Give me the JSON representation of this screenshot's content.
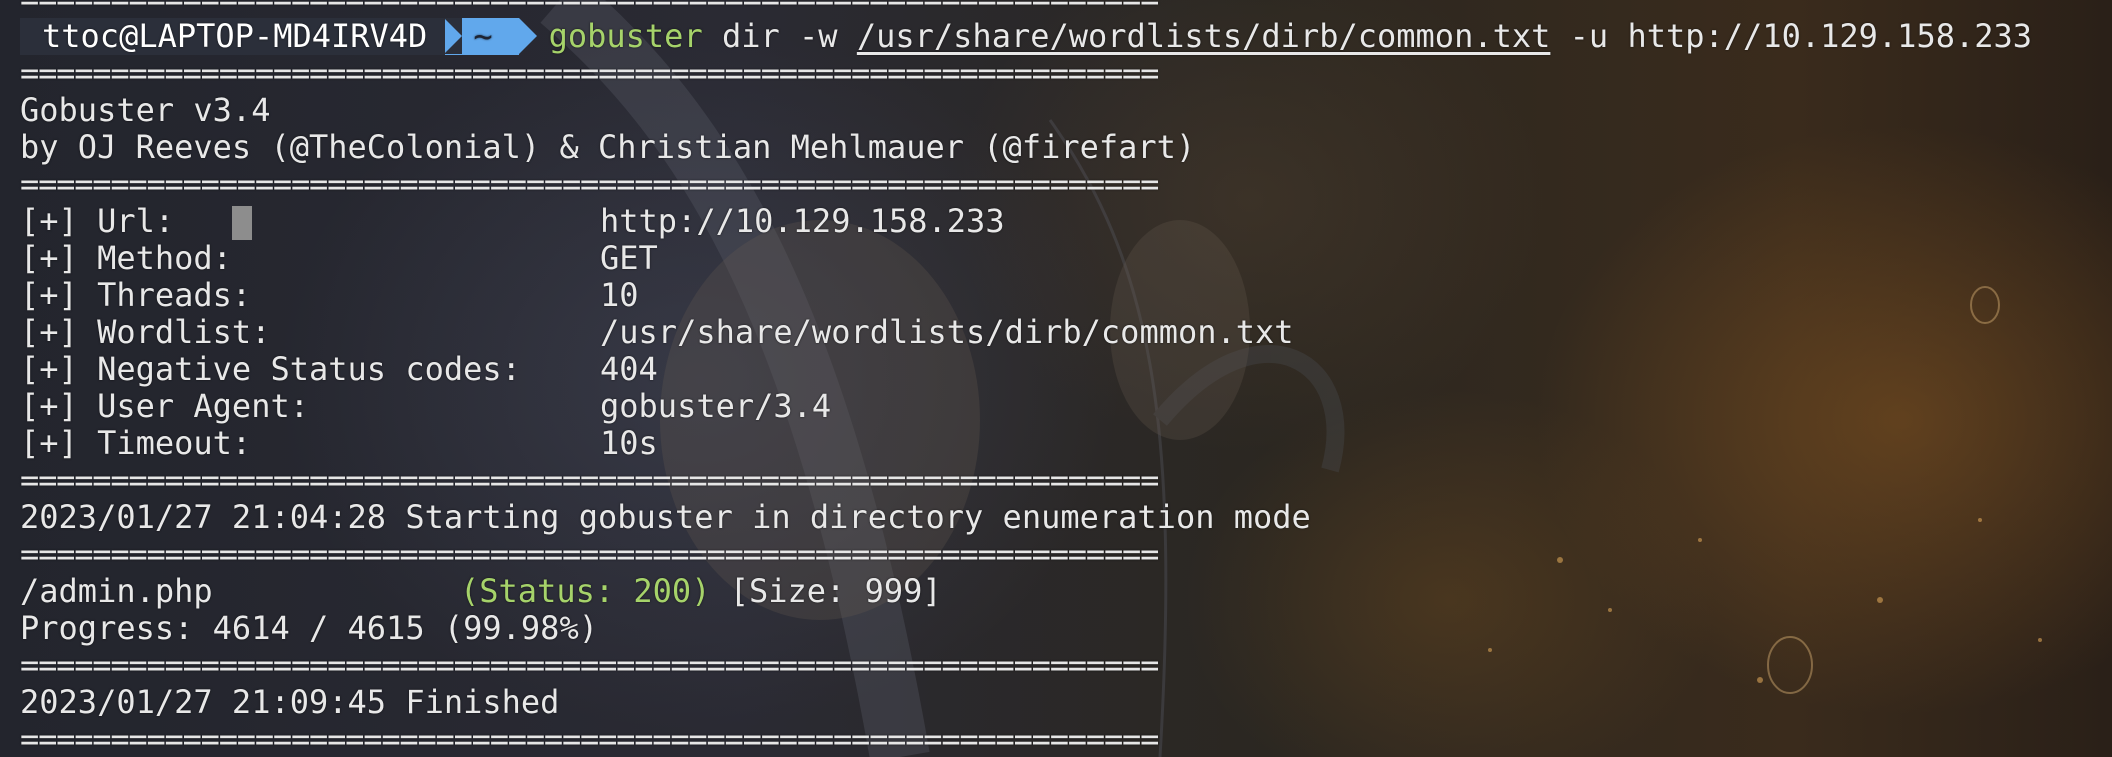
{
  "terminal": {
    "prompt": {
      "user_host": "ttoc@LAPTOP-MD4IRV4D",
      "directory": "~",
      "command": "gobuster",
      "args_before_path": " dir -w ",
      "wordlist_path": "/usr/share/wordlists/dirb/common.txt",
      "args_after_path": " -u http://10.129.158.233"
    },
    "separator": "===============================================================",
    "banner": {
      "title": "Gobuster v3.4",
      "credits": "by OJ Reeves (@TheColonial) & Christian Mehlmauer (@firefart)"
    },
    "config": [
      {
        "label": "[+] Url:",
        "value": "http://10.129.158.233"
      },
      {
        "label": "[+] Method:",
        "value": "GET"
      },
      {
        "label": "[+] Threads:",
        "value": "10"
      },
      {
        "label": "[+] Wordlist:",
        "value": "/usr/share/wordlists/dirb/common.txt"
      },
      {
        "label": "[+] Negative Status codes:",
        "value": "404"
      },
      {
        "label": "[+] User Agent:",
        "value": "gobuster/3.4"
      },
      {
        "label": "[+] Timeout:",
        "value": "10s"
      }
    ],
    "start_message": "2023/01/27 21:04:28 Starting gobuster in directory enumeration mode",
    "result": {
      "path": "/admin.php",
      "status": "(Status: 200)",
      "size": " [Size: 999]"
    },
    "progress": "Progress: 4614 / 4615 (99.98%)",
    "finish_message": "2023/01/27 21:09:45 Finished"
  },
  "colors": {
    "green": "#a6d36a",
    "prompt_blue": "#61a8ec",
    "prompt_dark": "#2b2f3a",
    "text": "#e8e8e8"
  }
}
